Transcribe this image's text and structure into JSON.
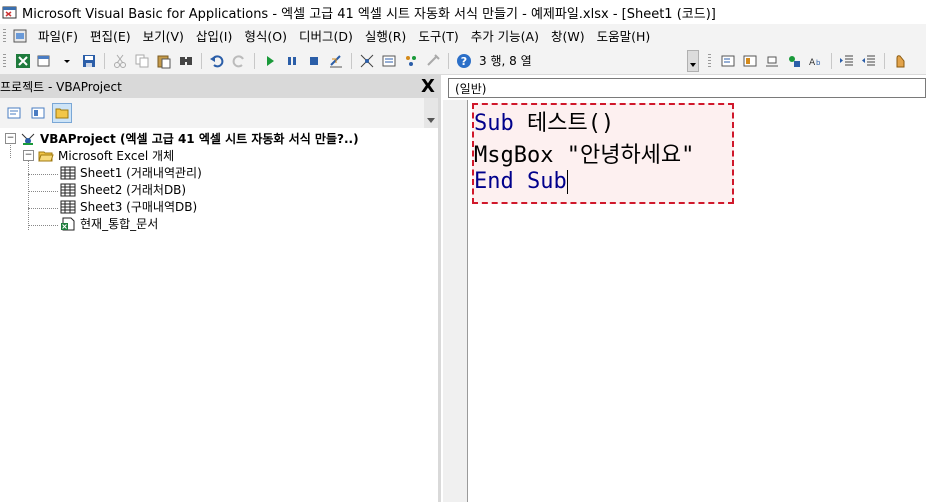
{
  "window": {
    "title": "Microsoft Visual Basic for Applications - 엑셀 고급 41 엑셀 시트 자동화 서식 만들기 - 예제파일.xlsx - [Sheet1 (코드)]"
  },
  "menu": {
    "items": [
      "파일(F)",
      "편집(E)",
      "보기(V)",
      "삽입(I)",
      "형식(O)",
      "디버그(D)",
      "실행(R)",
      "도구(T)",
      "추가 기능(A)",
      "창(W)",
      "도움말(H)"
    ]
  },
  "toolbar": {
    "position_text": "3 행, 8 열"
  },
  "project": {
    "title": "프로젝트 - VBAProject",
    "close_label": "X",
    "root": "VBAProject (엑셀 고급 41 엑셀 시트 자동화 서식 만들?..)",
    "folder": "Microsoft Excel 개체",
    "sheets": [
      "Sheet1 (거래내역관리)",
      "Sheet2 (거래처DB)",
      "Sheet3 (구매내역DB)"
    ],
    "workbook": "현재_통합_문서"
  },
  "code": {
    "object_combo": "(일반)",
    "line1_kw": "Sub",
    "line1_rest": " 테스트()",
    "line2": "MsgBox \"안녕하세요\"",
    "line3_kw": "End Sub"
  },
  "colors": {
    "highlight_border": "#d0182b",
    "highlight_fill": "#fdf0f0",
    "keyword": "#00008b"
  }
}
